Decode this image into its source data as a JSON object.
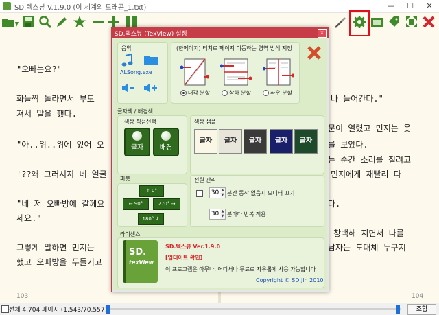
{
  "window": {
    "title": "SD.텍스뷰 V.1.9.0 (이 세계의 드래곤_1.txt)",
    "minimize": "—",
    "maximize": "☐",
    "close": "✕"
  },
  "toolbar": {
    "icons": [
      "folder-open-icon",
      "save-icon",
      "search-icon",
      "pencil-icon",
      "bookmark-star-icon",
      "minus-icon",
      "plus-icon",
      "columns-icon",
      "brush-icon",
      "gear-icon",
      "image-icon",
      "tag-icon",
      "fullscreen-icon",
      "close-icon"
    ]
  },
  "book": {
    "lines": [
      {
        "left": "\"오빠는요?\"",
        "right": ""
      },
      {
        "left": "화들짝 놀라면서 부모",
        "right": "나 들어간다.\""
      },
      {
        "left": "져서 말을 했다.",
        "right": ""
      },
      {
        "left": "",
        "right": "문이 열렸고 민지는 웃"
      },
      {
        "left": "\"아..위..위에 있어 오",
        "right": "를 보았다."
      },
      {
        "left": "",
        "right": "는 순간 소리를 칠려고"
      },
      {
        "left": "'??왜 그러시지 네 얼굴",
        "right": "민지에게 재빨리 다"
      },
      {
        "left": "\"네 저 오빠방에 갈께요",
        "right": "다."
      },
      {
        "left": "세요.\"",
        "right": ""
      },
      {
        "left": "",
        "right": "창백해 지면서 나를"
      },
      {
        "left": "그렇게 말하면 민지는",
        "right": "남자는 도대체 누구지"
      },
      {
        "left": "했고 오빠방을 두들기고",
        "right": ""
      }
    ],
    "left_page_no": "103",
    "right_page_no": "104"
  },
  "status": {
    "text": "전체 4,704 페이지 (1,543/70,557)",
    "zoom_label": "조합",
    "progress": 0.33
  },
  "dialog": {
    "title": "SD.텍스뷰 (TexView) 설정",
    "close": "x",
    "music": {
      "header": "음악",
      "alsong": "ALSong.exe"
    },
    "touch": {
      "header": "(한페이지) 터치로 페이지 이동하는 영역 방식 지정",
      "options": [
        "대각 분할",
        "상하 분할",
        "좌우 분할"
      ],
      "selected": 0
    },
    "colors": {
      "header": "글자색 / 배경색",
      "direct_header": "색상 직접선택",
      "text_btn": "글자",
      "bg_btn": "배경",
      "sample_header": "색상 샘플",
      "samples": [
        {
          "label": "글자",
          "bg": "#faf7e6",
          "fg": "#222222"
        },
        {
          "label": "글자",
          "bg": "#e8e6da",
          "fg": "#222222"
        },
        {
          "label": "글자",
          "bg": "#3a3a3a",
          "fg": "#ffffff"
        },
        {
          "label": "글자",
          "bg": "#1a1f6a",
          "fg": "#ffffff"
        },
        {
          "label": "글자",
          "bg": "#1d4a2a",
          "fg": "#ffffff"
        }
      ]
    },
    "pivot": {
      "header": "피봇",
      "btn_0": "↑ 0°",
      "btn_90": "← 90°",
      "btn_270": "270° →",
      "btn_180": "180° ↓"
    },
    "power": {
      "header": "전원 관리",
      "monitor_value": "30",
      "monitor_label": "분간 동작 없음시 모니터 끄기",
      "repeat_value": "30",
      "repeat_label": "분마다 반복 적용"
    },
    "license": {
      "header": "라이센스",
      "book_line1": "SD.",
      "book_line2": "texView",
      "version": "SD.텍스뷰 Ver.1.9.0",
      "update": "[업데이트 확인]",
      "desc": "이 프로그램은 아무나, 어디서나 무료로 자유롭게 사용 가능합니다",
      "copyright": "Copyright © SD.Jin 2010"
    }
  }
}
